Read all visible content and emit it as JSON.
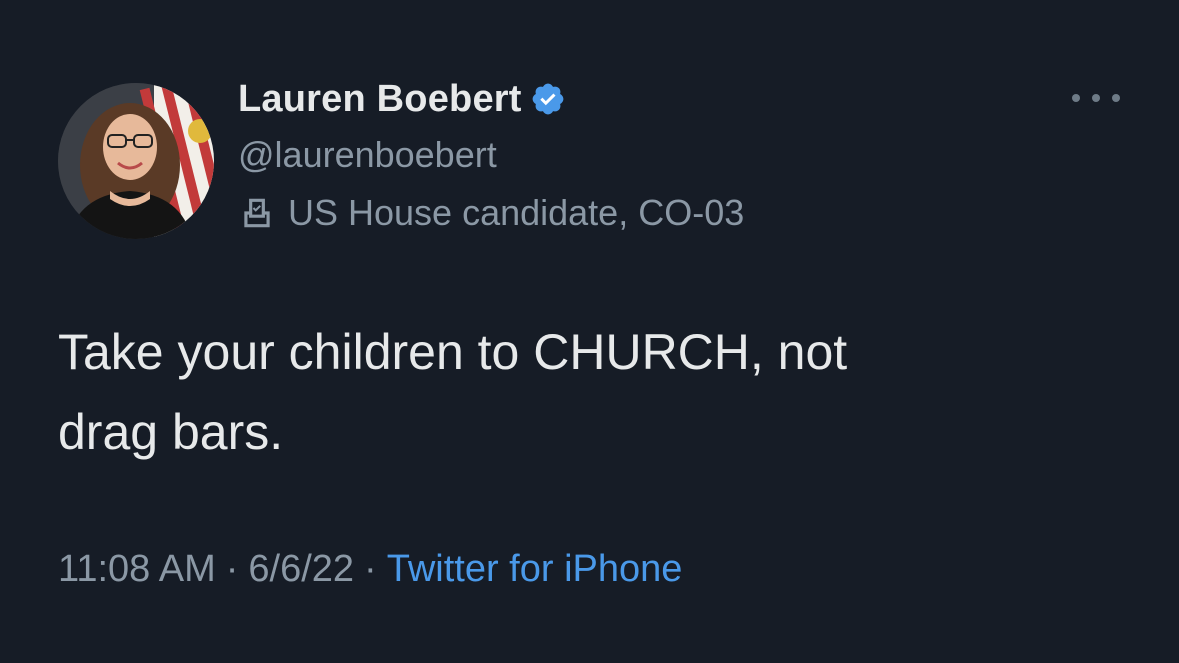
{
  "author": {
    "display_name": "Lauren Boebert",
    "handle": "@laurenboebert",
    "verified_icon": "verified-badge-icon",
    "label_icon": "ballot-box-icon",
    "label": "US House candidate, CO-03"
  },
  "tweet": {
    "text_line1": "Take your children to CHURCH, not",
    "text_line2": "drag bars."
  },
  "meta": {
    "time": "11:08 AM",
    "separator": "·",
    "date": "6/6/22",
    "source": "Twitter for iPhone"
  },
  "colors": {
    "background": "#161c26",
    "text_primary": "#e7e9ea",
    "text_secondary": "#8b98a5",
    "link": "#4a99e9",
    "verified": "#4a99e9"
  }
}
